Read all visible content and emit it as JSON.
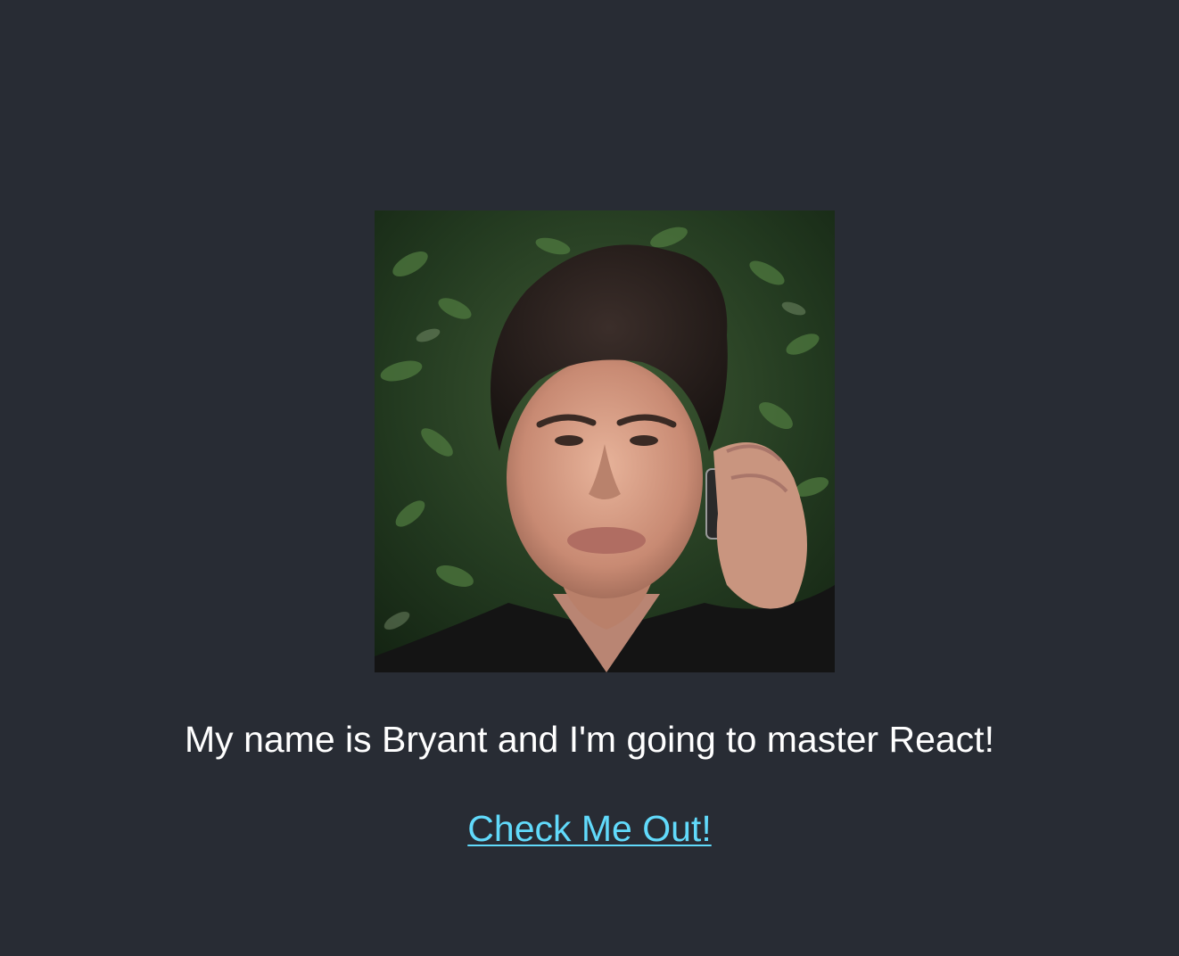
{
  "colors": {
    "background": "#282c34",
    "text": "#ffffff",
    "link": "#61dafb"
  },
  "profile": {
    "photo_subject": "portrait-photo"
  },
  "intro": {
    "text": "My name is Bryant and I'm going to master React!"
  },
  "cta": {
    "label": "Check Me Out!"
  }
}
